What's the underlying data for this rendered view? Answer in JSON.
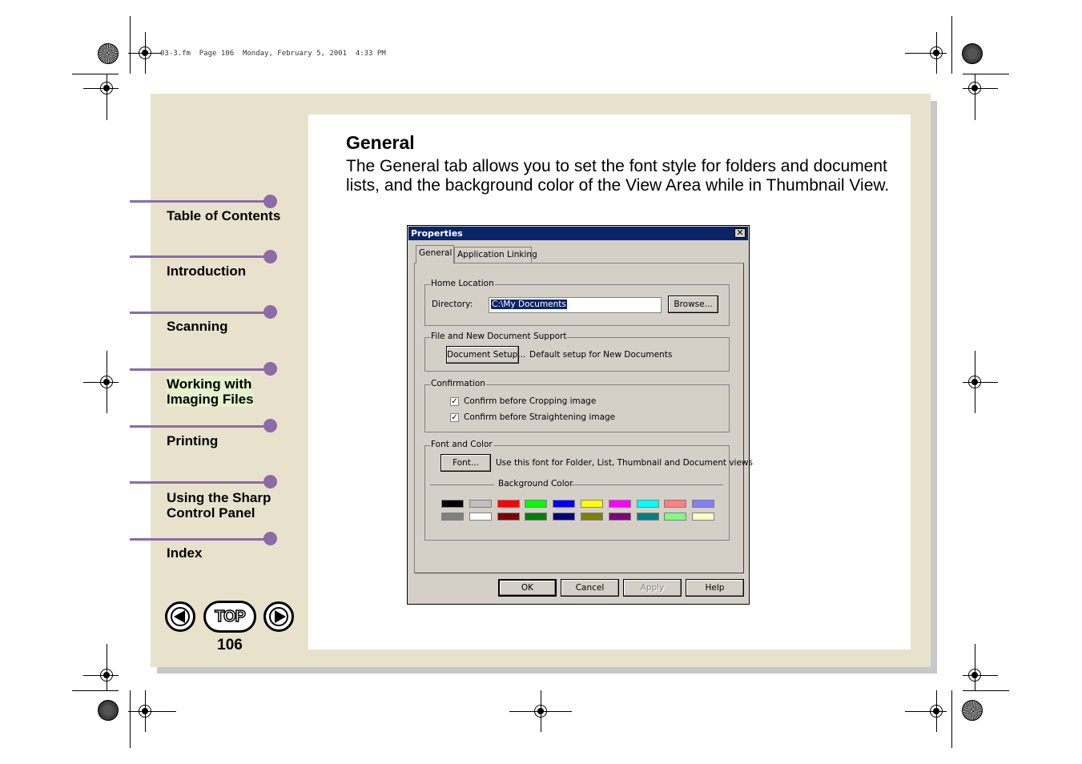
{
  "print_header": "03-3.fm  Page 106  Monday, February 5, 2001  4:33 PM",
  "sidebar": {
    "items": [
      {
        "label": "Table of Contents"
      },
      {
        "label": "Introduction"
      },
      {
        "label": "Scanning"
      },
      {
        "label_line1": "Working with",
        "label_line2": "Imaging Files"
      },
      {
        "label": "Printing"
      },
      {
        "label_line1": "Using the Sharp",
        "label_line2": "Control Panel"
      },
      {
        "label": "Index"
      }
    ],
    "top_label": "TOP",
    "page_number": "106",
    "accent_color": "#8d6aa8"
  },
  "main": {
    "heading": "General",
    "body": "The General tab allows you to set the font style for folders and document lists, and the background color of the View Area while in Thumbnail View."
  },
  "dialog": {
    "title": "Properties",
    "close_glyph": "✕",
    "tabs": [
      "General",
      "Application Linking"
    ],
    "home_location": {
      "group": "Home Location",
      "directory_label": "Directory:",
      "directory_value": "C:\\My Documents",
      "browse_label": "Browse..."
    },
    "file_support": {
      "group": "File and New Document Support",
      "button_label": "Document Setup...",
      "description": "Default setup for New Documents"
    },
    "confirmation": {
      "group": "Confirmation",
      "items": [
        {
          "label": "Confirm before Cropping image",
          "checked": true
        },
        {
          "label": "Confirm before Straightening image",
          "checked": true
        }
      ]
    },
    "font_color": {
      "group": "Font and Color",
      "font_button": "Font...",
      "font_description": "Use this font for Folder, List, Thumbnail and Document views",
      "background_label": "Background Color",
      "colors_row1": [
        "#000000",
        "#c0c0c0",
        "#ff0000",
        "#00ff00",
        "#0000ff",
        "#ffff00",
        "#ff00ff",
        "#00ffff",
        "#ff8080",
        "#8080ff"
      ],
      "colors_row2": [
        "#808080",
        "#ffffff",
        "#800000",
        "#008000",
        "#000080",
        "#808000",
        "#800080",
        "#008080",
        "#80ff80",
        "#ffffc0"
      ]
    },
    "buttons": {
      "ok": "OK",
      "cancel": "Cancel",
      "apply": "Apply",
      "help": "Help"
    }
  }
}
